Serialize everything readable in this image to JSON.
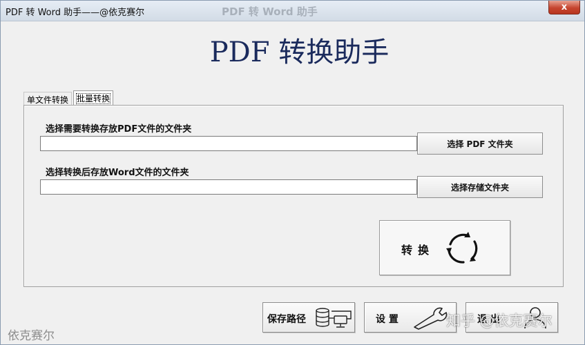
{
  "window": {
    "title": "PDF 转 Word 助手——@依克赛尔",
    "ghost_title": "PDF 转 Word 助手",
    "close_glyph": "x"
  },
  "app_title": "PDF  转换助手",
  "tabs": [
    {
      "label": "单文件转换",
      "selected": false
    },
    {
      "label": "批量转换",
      "selected": true
    }
  ],
  "batch": {
    "source_label": "选择需要转换存放PDF文件的文件夹",
    "source_value": "",
    "source_button": "选择 PDF 文件夹",
    "target_label": "选择转换后存放Word文件的文件夹",
    "target_value": "",
    "target_button": "选择存储文件夹",
    "convert_button": "转换",
    "convert_icon": "refresh-cycle-icon"
  },
  "bottom_buttons": [
    {
      "label": "保存路径",
      "icon": "database-network-icon"
    },
    {
      "label": "设 置",
      "icon": "wrench-icon"
    },
    {
      "label": "退 出",
      "icon": "user-icon"
    }
  ],
  "footer": {
    "author": "依克赛尔",
    "watermark": "知乎 @依克赛尔"
  },
  "colors": {
    "title_text": "#1a2a5c",
    "window_bg": "#f0f0f0",
    "close_red": "#c6452f"
  }
}
